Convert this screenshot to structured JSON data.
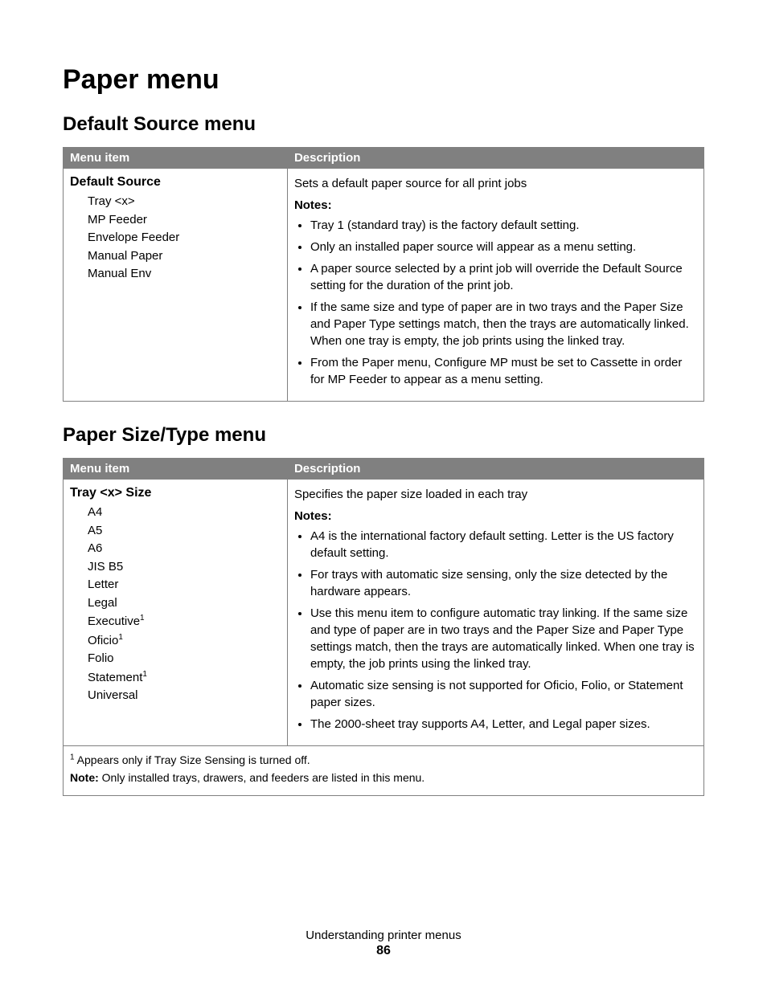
{
  "title": "Paper menu",
  "section1": {
    "heading": "Default Source menu",
    "header_menu": "Menu item",
    "header_desc": "Description",
    "item_title": "Default Source",
    "options": [
      "Tray <x>",
      "MP Feeder",
      "Envelope Feeder",
      "Manual Paper",
      "Manual Env"
    ],
    "desc_line": "Sets a default paper source for all print jobs",
    "notes_label": "Notes:",
    "notes": [
      "Tray 1 (standard tray) is the factory default setting.",
      "Only an installed paper source will appear as a menu setting.",
      "A paper source selected by a print job will override the Default Source setting for the duration of the print job.",
      "If the same size and type of paper are in two trays and the Paper Size and Paper Type settings match, then the trays are automatically linked. When one tray is empty, the job prints using the linked tray.",
      "From the Paper menu, Configure MP must be set to Cassette in order for MP Feeder to appear as a menu setting."
    ]
  },
  "section2": {
    "heading": "Paper Size/Type menu",
    "header_menu": "Menu item",
    "header_desc": "Description",
    "item_title": "Tray <x> Size",
    "options": [
      {
        "text": "A4",
        "sup": false
      },
      {
        "text": "A5",
        "sup": false
      },
      {
        "text": "A6",
        "sup": false
      },
      {
        "text": "JIS B5",
        "sup": false
      },
      {
        "text": "Letter",
        "sup": false
      },
      {
        "text": "Legal",
        "sup": false
      },
      {
        "text": "Executive",
        "sup": true
      },
      {
        "text": "Oficio",
        "sup": true
      },
      {
        "text": "Folio",
        "sup": false
      },
      {
        "text": "Statement",
        "sup": true
      },
      {
        "text": "Universal",
        "sup": false
      }
    ],
    "desc_line": "Specifies the paper size loaded in each tray",
    "notes_label": "Notes:",
    "notes": [
      "A4 is the international factory default setting. Letter is the US factory default setting.",
      "For trays with automatic size sensing, only the size detected by the hardware appears.",
      "Use this menu item to configure automatic tray linking. If the same size and type of paper are in two trays and the Paper Size and Paper Type settings match, then the trays are automatically linked. When one tray is empty, the job prints using the linked tray.",
      "Automatic size sensing is not supported for Oficio, Folio, or Statement paper sizes.",
      "The 2000-sheet tray supports A4, Letter, and Legal paper sizes."
    ],
    "footnote1_sup": "1",
    "footnote1": " Appears only if Tray Size Sensing is turned off.",
    "footnote2_bold": "Note:",
    "footnote2": " Only installed trays, drawers, and feeders are listed in this menu."
  },
  "footer": {
    "text": "Understanding printer menus",
    "page": "86"
  }
}
